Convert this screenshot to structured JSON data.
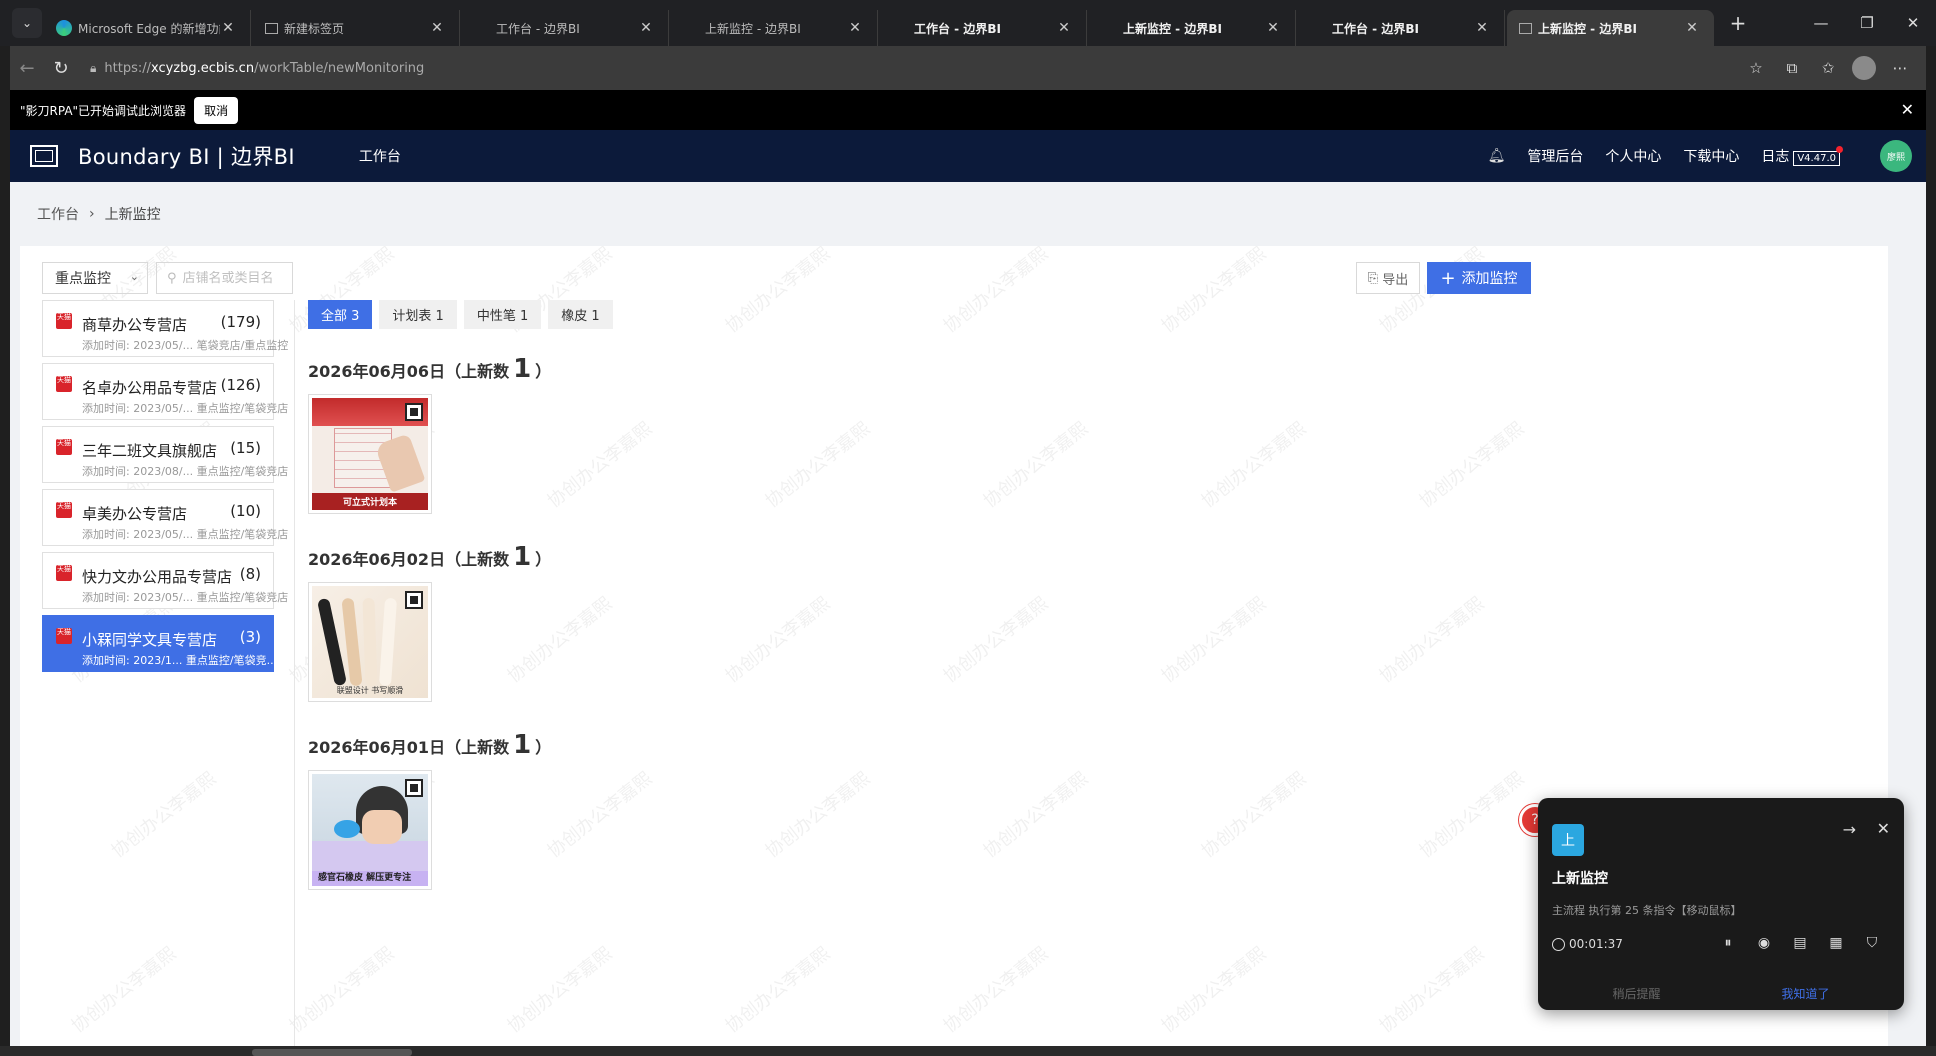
{
  "browser": {
    "tabs": [
      {
        "title": "Microsoft Edge 的新增功能",
        "icon": "edge-icon",
        "active": false,
        "bold": false
      },
      {
        "title": "新建标签页",
        "icon": "newtab-icon",
        "active": false,
        "bold": false
      },
      {
        "title": "工作台 - 边界BI",
        "icon": "",
        "active": false,
        "bold": false
      },
      {
        "title": "上新监控 - 边界BI",
        "icon": "",
        "active": false,
        "bold": false
      },
      {
        "title": "工作台 - 边界BI",
        "icon": "",
        "active": false,
        "bold": true
      },
      {
        "title": "上新监控 - 边界BI",
        "icon": "",
        "active": false,
        "bold": true
      },
      {
        "title": "工作台 - 边界BI",
        "icon": "",
        "active": false,
        "bold": true
      },
      {
        "title": "上新监控 - 边界BI",
        "icon": "page-icon",
        "active": true,
        "bold": true
      }
    ],
    "url_prefix": "https://",
    "url_host": "xcyzbg.ecbis.cn",
    "url_path": "/workTable/newMonitoring",
    "rpa_notice": "\"影刀RPA\"已开始调试此浏览器",
    "rpa_cancel": "取消"
  },
  "header": {
    "brand": "Boundary BI | 边界BI",
    "nav_work": "工作台",
    "admin": "管理后台",
    "personal": "个人中心",
    "download": "下载中心",
    "log": "日志",
    "version": "V4.47.0",
    "avatar_text": "廖熙"
  },
  "breadcrumb": {
    "root": "工作台",
    "current": "上新监控"
  },
  "toolbar": {
    "filter_value": "重点监控",
    "search_placeholder": "店铺名或类目名",
    "export_label": "导出",
    "add_label": "添加监控"
  },
  "shops": [
    {
      "name": "商草办公专营店",
      "count": "(179)",
      "info": "添加时间: 2023/05/... 笔袋竞店/重点监控",
      "active": false
    },
    {
      "name": "名卓办公用品专营店",
      "count": "(126)",
      "info": "添加时间: 2023/05/... 重点监控/笔袋竞店",
      "active": false
    },
    {
      "name": "三年二班文具旗舰店",
      "count": "(15)",
      "info": "添加时间: 2023/08/... 重点监控/笔袋竞店",
      "active": false
    },
    {
      "name": "卓美办公专营店",
      "count": "(10)",
      "info": "添加时间: 2023/05/... 重点监控/笔袋竞店",
      "active": false
    },
    {
      "name": "快力文办公用品专营店",
      "count": "(8)",
      "info": "添加时间: 2023/05/... 重点监控/笔袋竞店",
      "active": false
    },
    {
      "name": "小槑同学文具专营店",
      "count": "(3)",
      "info": "添加时间: 2023/1... 重点监控/笔袋竞...",
      "active": true
    }
  ],
  "filter_tabs": [
    {
      "label": "全部 3",
      "active": true
    },
    {
      "label": "计划表 1",
      "active": false
    },
    {
      "label": "中性笔 1",
      "active": false
    },
    {
      "label": "橡皮 1",
      "active": false
    }
  ],
  "days": [
    {
      "date": "2026年06月06日",
      "open": "（上新数",
      "num": "1",
      "close": "）",
      "caption": "可立式计划本"
    },
    {
      "date": "2026年06月02日",
      "open": "（上新数",
      "num": "1",
      "close": "）",
      "caption": "联盟设计 书写顺滑"
    },
    {
      "date": "2026年06月01日",
      "open": "（上新数",
      "num": "1",
      "close": "）",
      "caption": "感官石橡皮 解压更专注"
    }
  ],
  "watermark_text": "协创办公李嘉熙",
  "rpa_popup": {
    "icon_text": "上",
    "title": "上新监控",
    "status": "主流程 执行第 25 条指令【移动鼠标】",
    "timer": "00:01:37",
    "bottom_left": "稍后提醒",
    "bottom_right": "我知道了"
  }
}
